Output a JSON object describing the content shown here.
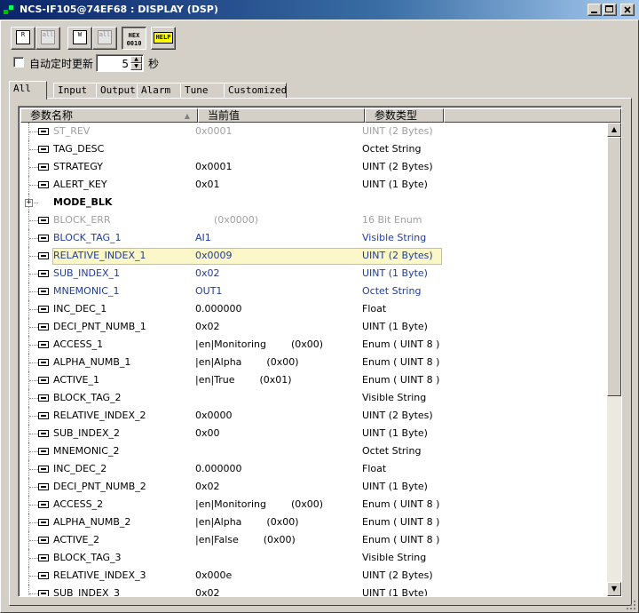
{
  "window": {
    "title": "NCS-IF105@74EF68 : DISPLAY (DSP)"
  },
  "toolbar": {
    "read_button": {
      "icon": "R"
    },
    "read_all_button": {
      "icon": "all"
    },
    "write_button": {
      "icon": "W"
    },
    "write_all_button": {
      "icon": "all"
    },
    "hex_button": {
      "line1": "HEX",
      "line2": "0010"
    },
    "help_button": {
      "label": "HELP"
    }
  },
  "auto_refresh": {
    "label": "自动定时更新",
    "value": "5",
    "unit": "秒"
  },
  "tabs": [
    "All",
    "Input",
    "Output",
    "Alarm",
    "Tune",
    "Customized"
  ],
  "columns": {
    "name": "参数名称",
    "value": "当前值",
    "type": "参数类型"
  },
  "rows": [
    {
      "name": "ST_REV",
      "value": "0x0001",
      "type": "UINT (2 Bytes)",
      "style": "gray"
    },
    {
      "name": "TAG_DESC",
      "value": "",
      "type": "Octet String",
      "style": ""
    },
    {
      "name": "STRATEGY",
      "value": "0x0001",
      "type": "UINT (2 Bytes)",
      "style": ""
    },
    {
      "name": "ALERT_KEY",
      "value": "0x01",
      "type": "UINT (1 Byte)",
      "style": ""
    },
    {
      "name": "MODE_BLK",
      "value": "",
      "type": "",
      "style": "bold"
    },
    {
      "name": "BLOCK_ERR",
      "value": "      (0x0000)",
      "type": "16 Bit Enum",
      "style": "gray"
    },
    {
      "name": "BLOCK_TAG_1",
      "value": "AI1",
      "type": "Visible String",
      "style": "blue"
    },
    {
      "name": "RELATIVE_INDEX_1",
      "value": "0x0009",
      "type": "UINT (2 Bytes)",
      "style": "blue sel"
    },
    {
      "name": "SUB_INDEX_1",
      "value": "0x02",
      "type": "UINT (1 Byte)",
      "style": "blue"
    },
    {
      "name": "MNEMONIC_1",
      "value": "OUT1",
      "type": "Octet String",
      "style": "blue"
    },
    {
      "name": "INC_DEC_1",
      "value": "0.000000",
      "type": "Float",
      "style": ""
    },
    {
      "name": "DECI_PNT_NUMB_1",
      "value": "0x02",
      "type": "UINT (1 Byte)",
      "style": ""
    },
    {
      "name": "ACCESS_1",
      "value": "|en|Monitoring        (0x00)",
      "type": "Enum ( UINT 8 )",
      "style": ""
    },
    {
      "name": "ALPHA_NUMB_1",
      "value": "|en|Alpha        (0x00)",
      "type": "Enum ( UINT 8 )",
      "style": ""
    },
    {
      "name": "ACTIVE_1",
      "value": "|en|True        (0x01)",
      "type": "Enum ( UINT 8 )",
      "style": ""
    },
    {
      "name": "BLOCK_TAG_2",
      "value": "",
      "type": "Visible String",
      "style": ""
    },
    {
      "name": "RELATIVE_INDEX_2",
      "value": "0x0000",
      "type": "UINT (2 Bytes)",
      "style": ""
    },
    {
      "name": "SUB_INDEX_2",
      "value": "0x00",
      "type": "UINT (1 Byte)",
      "style": ""
    },
    {
      "name": "MNEMONIC_2",
      "value": "",
      "type": "Octet String",
      "style": ""
    },
    {
      "name": "INC_DEC_2",
      "value": "0.000000",
      "type": "Float",
      "style": ""
    },
    {
      "name": "DECI_PNT_NUMB_2",
      "value": "0x02",
      "type": "UINT (1 Byte)",
      "style": ""
    },
    {
      "name": "ACCESS_2",
      "value": "|en|Monitoring        (0x00)",
      "type": "Enum ( UINT 8 )",
      "style": ""
    },
    {
      "name": "ALPHA_NUMB_2",
      "value": "|en|Alpha        (0x00)",
      "type": "Enum ( UINT 8 )",
      "style": ""
    },
    {
      "name": "ACTIVE_2",
      "value": "|en|False        (0x00)",
      "type": "Enum ( UINT 8 )",
      "style": ""
    },
    {
      "name": "BLOCK_TAG_3",
      "value": "",
      "type": "Visible String",
      "style": ""
    },
    {
      "name": "RELATIVE_INDEX_3",
      "value": "0x000e",
      "type": "UINT (2 Bytes)",
      "style": ""
    },
    {
      "name": "SUB_INDEX_3",
      "value": "0x02",
      "type": "UINT (1 Byte)",
      "style": ""
    }
  ],
  "colors": {
    "title_start": "#0a246a",
    "title_end": "#a6caf0",
    "disabled_text": "#a0a0a0",
    "link_text": "#1e3c9c",
    "selection": "#fbf7c8"
  }
}
